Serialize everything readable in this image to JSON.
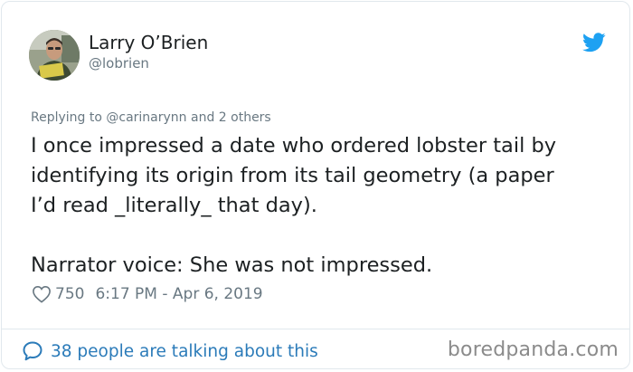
{
  "author": {
    "name": "Larry O’Brien",
    "handle": "@lobrien",
    "avatar_icon": "user-avatar"
  },
  "brand_icon": "twitter-bird-icon",
  "brand_color": "#1da1f2",
  "reply_context": "Replying to @carinarynn and 2 others",
  "tweet": {
    "lines": [
      "I once impressed a date who ordered lobster tail by",
      "identifying its origin from its tail geometry (a paper",
      "I’d read _literally_ that day).",
      "Narrator voice: She was not impressed."
    ]
  },
  "meta": {
    "likes": "750",
    "timestamp": "6:17 PM - Apr 6, 2019"
  },
  "footer": {
    "conversation_text": "38 people are talking about this",
    "link_color": "#2b7bb9"
  },
  "watermark": "boredpanda.com"
}
